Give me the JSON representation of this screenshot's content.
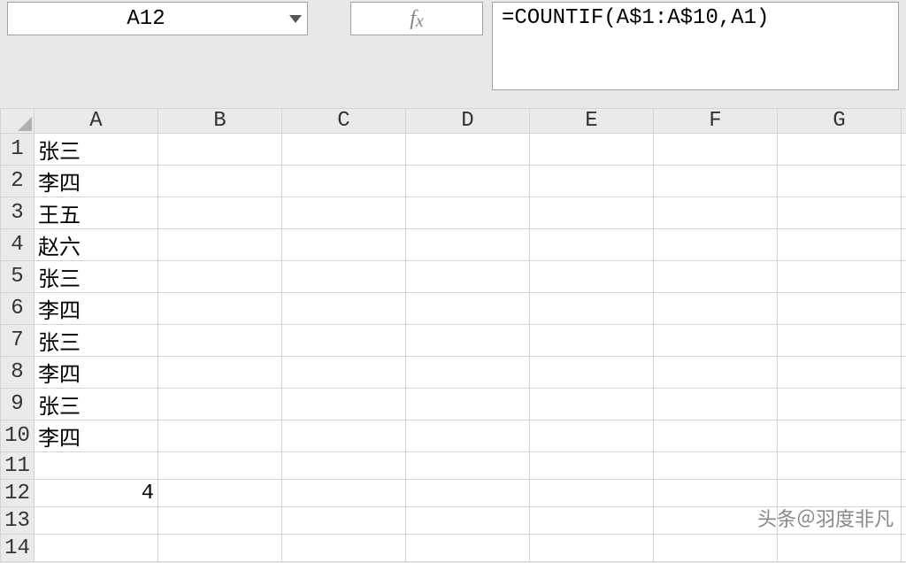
{
  "nameBox": {
    "value": "A12"
  },
  "fxLabel": "fx",
  "formulaBar": {
    "value": "=COUNTIF(A$1:A$10,A1)"
  },
  "columns": [
    "A",
    "B",
    "C",
    "D",
    "E",
    "F",
    "G"
  ],
  "rowCount": 14,
  "cells": {
    "A1": "张三",
    "A2": "李四",
    "A3": "王五",
    "A4": "赵六",
    "A5": "张三",
    "A6": "李四",
    "A7": "张三",
    "A8": "李四",
    "A9": "张三",
    "A10": "李四",
    "A12": "4"
  },
  "numericCells": [
    "A12"
  ],
  "watermark": "头条＠羽度非凡"
}
